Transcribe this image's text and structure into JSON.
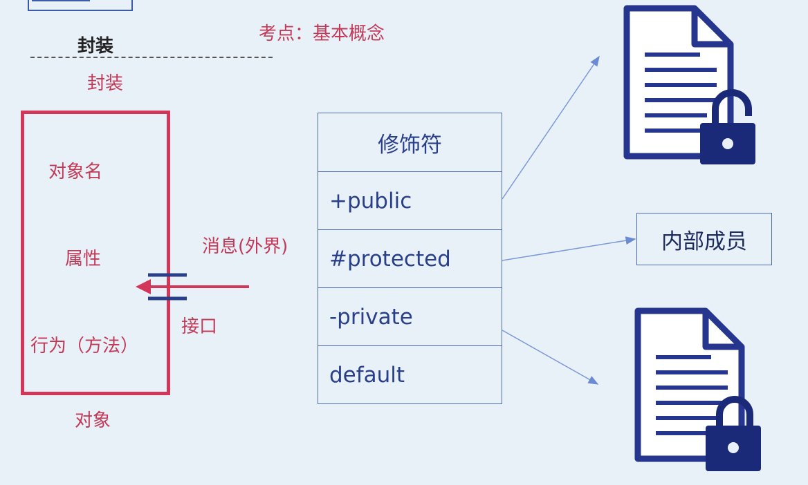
{
  "header": {
    "title": "封装",
    "topic": "考点：基本概念",
    "subtitle": "封装"
  },
  "object": {
    "name": "对象名",
    "attributes": "属性",
    "behavior": "行为（方法）",
    "caption": "对象"
  },
  "message": {
    "label": "消息(外界)",
    "interface": "接口"
  },
  "modifiers": {
    "header": "修饰符",
    "items": [
      "+public",
      "#protected",
      "-private",
      "default"
    ]
  },
  "inner_member": "内部成员",
  "colors": {
    "accent": "#d2375a",
    "navy": "#2a3f8a",
    "doc": "#26368f",
    "background": "#e8f1f8"
  },
  "icons": [
    "document-lock-icon",
    "document-lock-icon"
  ]
}
